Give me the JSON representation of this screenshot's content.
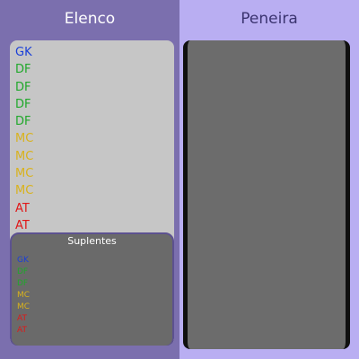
{
  "elenco": {
    "title": "Elenco",
    "starters": [
      {
        "label": "GK",
        "color": "#1a3fd8"
      },
      {
        "label": "DF",
        "color": "#1fa82a"
      },
      {
        "label": "DF",
        "color": "#1fa82a"
      },
      {
        "label": "DF",
        "color": "#1fa82a"
      },
      {
        "label": "DF",
        "color": "#1fa82a"
      },
      {
        "label": "MC",
        "color": "#d9b21c"
      },
      {
        "label": "MC",
        "color": "#d9b21c"
      },
      {
        "label": "MC",
        "color": "#d9b21c"
      },
      {
        "label": "MC",
        "color": "#d9b21c"
      },
      {
        "label": "AT",
        "color": "#e01818"
      },
      {
        "label": "AT",
        "color": "#e01818"
      }
    ],
    "substitutes": {
      "title": "Suplentes",
      "items": [
        {
          "label": "GK",
          "color": "#1a3fd8"
        },
        {
          "label": "DF",
          "color": "#1fa82a"
        },
        {
          "label": "DF",
          "color": "#1fa82a"
        },
        {
          "label": "MC",
          "color": "#d9b21c"
        },
        {
          "label": "MC",
          "color": "#d9b21c"
        },
        {
          "label": "AT",
          "color": "#e01818"
        },
        {
          "label": "AT",
          "color": "#e01818"
        }
      ]
    }
  },
  "peneira": {
    "title": "Peneira"
  }
}
